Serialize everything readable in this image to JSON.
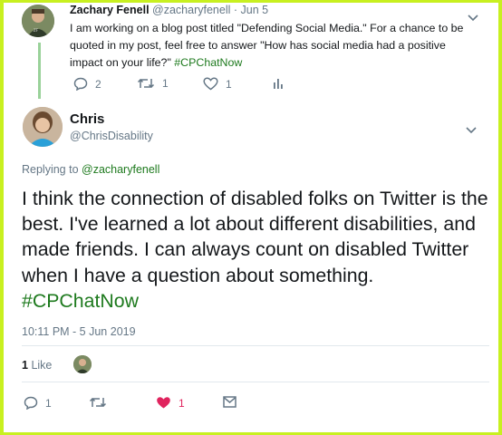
{
  "parent_tweet": {
    "name": "Zachary Fenell",
    "handle": "@zacharyfenell",
    "separator": "·",
    "date": "Jun 5",
    "text_main": "I am working on a blog post titled \"Defending Social Media.\" For a chance to be quoted in my post,  feel free to answer \"How has social media had a positive impact on your life?\" ",
    "hashtag": "#CPChatNow",
    "actions": {
      "replies": "2",
      "retweets": "1",
      "likes": "1"
    }
  },
  "main_tweet": {
    "name": "Chris",
    "handle": "@ChrisDisability",
    "replying_prefix": "Replying to ",
    "replying_to": "@zacharyfenell",
    "text_main": "I think the connection of disabled folks on Twitter is the best. I've learned a lot about different disabilities, and made friends. I can always count on disabled Twitter when I have a question about something. ",
    "hashtag": "#CPChatNow",
    "timestamp": "10:11 PM - 5 Jun 2019",
    "likes_count": "1",
    "likes_label": "Like",
    "actions": {
      "replies": "1",
      "likes": "1"
    }
  },
  "colors": {
    "border": "#c8f020",
    "hashtag": "#1e7a1e",
    "heart": "#e0245e",
    "muted": "#657786",
    "thread": "#9ad29a"
  },
  "icons": {
    "reply": "reply-icon",
    "retweet": "retweet-icon",
    "like": "heart-icon",
    "analytics": "analytics-icon",
    "dm": "envelope-icon",
    "caret": "chevron-down-icon"
  }
}
